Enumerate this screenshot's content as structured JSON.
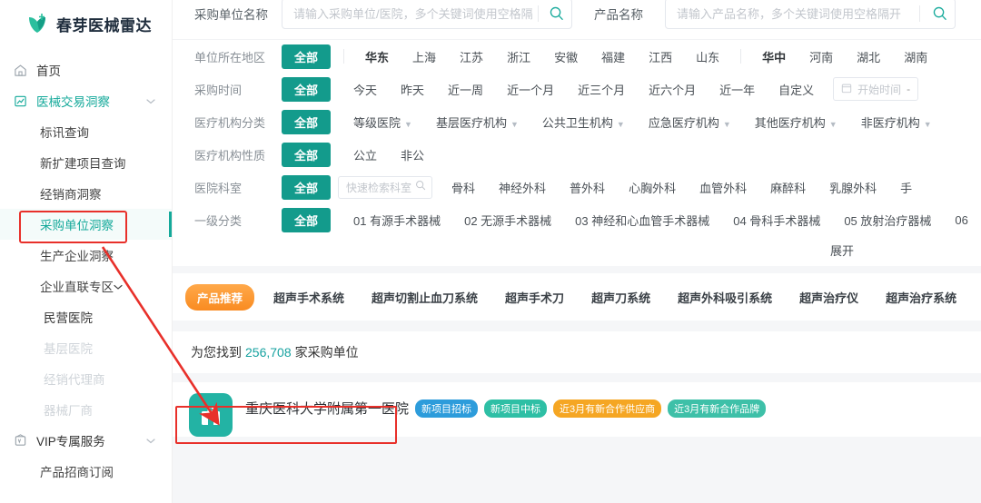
{
  "brand": {
    "name": "春芽医械雷达",
    "logo_icon": "leaf-heart-logo"
  },
  "sidebar": {
    "items": [
      {
        "label": "首页",
        "icon": "home-icon",
        "type": "top"
      },
      {
        "label": "医械交易洞察",
        "icon": "chart-board-icon",
        "type": "top-active",
        "chevron": "⌄"
      },
      {
        "label": "标讯查询",
        "type": "sub"
      },
      {
        "label": "新扩建项目查询",
        "type": "sub"
      },
      {
        "label": "经销商洞察",
        "type": "sub"
      },
      {
        "label": "采购单位洞察",
        "type": "sub-selected"
      },
      {
        "label": "生产企业洞察",
        "type": "sub"
      },
      {
        "label": "企业直联专区",
        "type": "sub",
        "chevron": "⌄"
      },
      {
        "label": "民营医院",
        "type": "sub2"
      },
      {
        "label": "基层医院",
        "type": "sub2-disabled"
      },
      {
        "label": "经销代理商",
        "type": "sub2-disabled"
      },
      {
        "label": "器械厂商",
        "type": "sub2-disabled"
      },
      {
        "label": "VIP专属服务",
        "icon": "vip-icon",
        "type": "top",
        "chevron": "⌄"
      },
      {
        "label": "产品招商订阅",
        "type": "sub"
      }
    ]
  },
  "search": {
    "unit": {
      "label": "采购单位名称",
      "placeholder": "请输入采购单位/医院，多个关键词使用空格隔开",
      "value": "",
      "icon": "search-icon"
    },
    "product": {
      "label": "产品名称",
      "placeholder": "请输入产品名称，多个关键词使用空格隔开",
      "value": "",
      "icon": "search-icon"
    }
  },
  "filters": {
    "all_label": "全部",
    "rows": [
      {
        "label": "单位所在地区",
        "options": [
          "华东",
          "上海",
          "江苏",
          "浙江",
          "安徽",
          "福建",
          "江西",
          "山东",
          "华中",
          "河南",
          "湖北",
          "湖南"
        ],
        "groups": [
          0,
          8
        ],
        "separators": [
          0,
          8
        ]
      },
      {
        "label": "采购时间",
        "options": [
          "今天",
          "昨天",
          "近一周",
          "近一个月",
          "近三个月",
          "近六个月",
          "近一年",
          "自定义"
        ],
        "date_picker": {
          "icon": "calendar-icon",
          "placeholder": "开始时间",
          "dash": "-"
        }
      },
      {
        "label": "医疗机构分类",
        "options": [
          "等级医院",
          "基层医疗机构",
          "公共卫生机构",
          "应急医疗机构",
          "其他医疗机构",
          "非医疗机构"
        ],
        "dropdown": true
      },
      {
        "label": "医疗机构性质",
        "options": [
          "公立",
          "非公"
        ]
      },
      {
        "label": "医院科室",
        "mini_search": {
          "placeholder": "快速检索科室",
          "icon": "search-icon"
        },
        "options": [
          "骨科",
          "神经外科",
          "普外科",
          "心胸外科",
          "血管外科",
          "麻醉科",
          "乳腺外科",
          "手"
        ]
      },
      {
        "label": "一级分类",
        "options": [
          "01 有源手术器械",
          "02 无源手术器械",
          "03 神经和心血管手术器械",
          "04 骨科手术器械",
          "05 放射治疗器械",
          "06"
        ]
      }
    ],
    "expand_label": "展开"
  },
  "product_strip": {
    "tag": "产品推荐",
    "items": [
      "超声手术系统",
      "超声切割止血刀系统",
      "超声手术刀",
      "超声刀系统",
      "超声外科吸引系统",
      "超声治疗仪",
      "超声治疗系统"
    ]
  },
  "result": {
    "prefix": "为您找到",
    "count": "256,708",
    "suffix": "家采购单位"
  },
  "result_card": {
    "avatar_icon": "hospital-icon",
    "title": "重庆医科大学附属第一医院",
    "badges": [
      {
        "text": "新项目招标",
        "color": "#2d9cdb"
      },
      {
        "text": "新项目中标",
        "color": "#2ebfa5"
      },
      {
        "text": "近3月有新合作供应商",
        "color": "#f5a623"
      },
      {
        "text": "近3月有新合作品牌",
        "color": "#3ec0a8"
      }
    ]
  },
  "annotations": {
    "accent_color": "#e8302a",
    "boxes": [
      "sidebar-item-highlight",
      "result-count-highlight"
    ],
    "arrow": "arrow-from-sidebar-to-result"
  }
}
